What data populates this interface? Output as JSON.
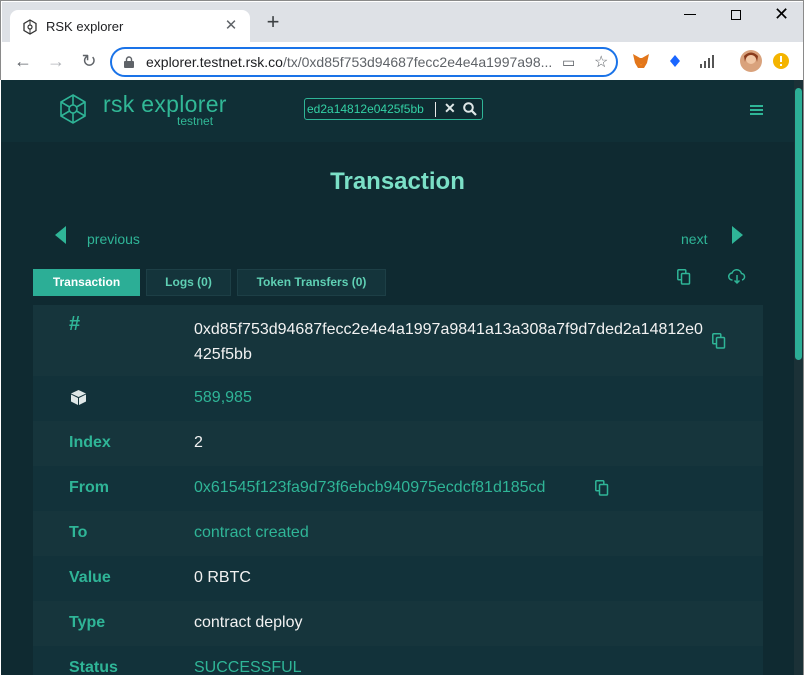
{
  "browser": {
    "tab_title": "RSK explorer",
    "url_host": "explorer.testnet.rsk.co",
    "url_path": "/tx/0xd85f753d94687fecc2e4e4a1997a98..."
  },
  "site": {
    "logo_text": "rsk explorer",
    "logo_sub": "testnet",
    "search_value": "ed2a14812e0425f5bb"
  },
  "page": {
    "title": "Transaction",
    "prev_label": "previous",
    "next_label": "next",
    "tabs": [
      {
        "label": "Transaction",
        "active": true
      },
      {
        "label": "Logs (0)",
        "active": false
      },
      {
        "label": "Token Transfers (0)",
        "active": false
      }
    ]
  },
  "details": {
    "hash": "0xd85f753d94687fecc2e4e4a1997a9841a13a308a7f9d7ded2a14812e0425f5bb",
    "block": "589,985",
    "index_label": "Index",
    "index": "2",
    "from_label": "From",
    "from": "0x61545f123fa9d73f6ebcb940975ecdcf81d185cd",
    "to_label": "To",
    "to": "contract created",
    "value_label": "Value",
    "value": "0 RBTC",
    "type_label": "Type",
    "type": "contract deploy",
    "status_label": "Status",
    "status": "SUCCESSFUL"
  },
  "colors": {
    "accent": "#2fb597",
    "background": "#0f2a31",
    "title": "#7be0c7"
  },
  "icons": [
    "settings-gear-icon",
    "close-icon",
    "lock-icon",
    "cast-icon",
    "star-icon",
    "metamask-icon",
    "binance-icon",
    "signal-icon",
    "avatar",
    "warning-icon",
    "search-icon",
    "hamburger-icon",
    "copy-icon",
    "download-icon",
    "hash-icon",
    "cube-icon"
  ]
}
